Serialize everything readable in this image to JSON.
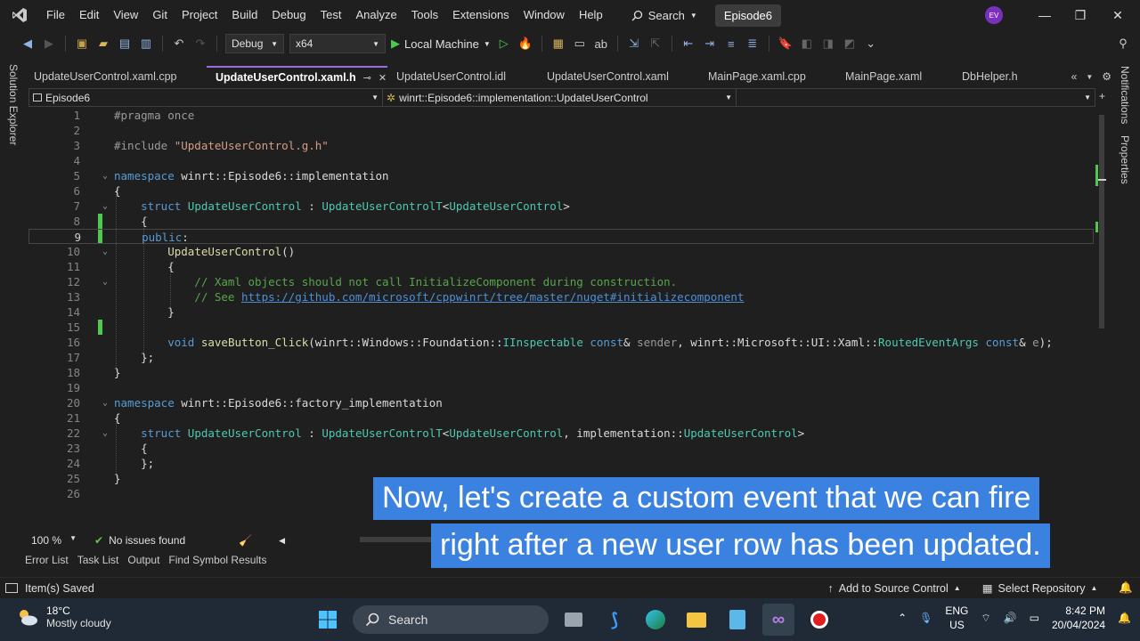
{
  "menubar": {
    "items": [
      "File",
      "Edit",
      "View",
      "Git",
      "Project",
      "Build",
      "Debug",
      "Test",
      "Analyze",
      "Tools",
      "Extensions",
      "Window",
      "Help"
    ],
    "search_label": "Search",
    "solution_name": "Episode6",
    "avatar_initials": "EV"
  },
  "toolbar": {
    "config": "Debug",
    "platform": "x64",
    "run_label": "Local Machine"
  },
  "side_panels": {
    "left": "Solution Explorer",
    "right_top": "Notifications",
    "right_bottom": "Properties"
  },
  "tabs": [
    {
      "label": "UpdateUserControl.xaml.cpp",
      "active": false
    },
    {
      "label": "UpdateUserControl.xaml.h",
      "active": true
    },
    {
      "label": "UpdateUserControl.idl",
      "active": false
    },
    {
      "label": "UpdateUserControl.xaml",
      "active": false
    },
    {
      "label": "MainPage.xaml.cpp",
      "active": false
    },
    {
      "label": "MainPage.xaml",
      "active": false
    },
    {
      "label": "DbHelper.h",
      "active": false
    }
  ],
  "navbar": {
    "project": "Episode6",
    "scope": "winrt::Episode6::implementation::UpdateUserControl",
    "member": ""
  },
  "code_lines": [
    {
      "n": "1",
      "text": "#pragma once"
    },
    {
      "n": "2",
      "text": ""
    },
    {
      "n": "3",
      "text": "#include \"UpdateUserControl.g.h\""
    },
    {
      "n": "4",
      "text": ""
    },
    {
      "n": "5",
      "text": "namespace winrt::Episode6::implementation"
    },
    {
      "n": "6",
      "text": "{"
    },
    {
      "n": "7",
      "text": "    struct UpdateUserControl : UpdateUserControlT<UpdateUserControl>"
    },
    {
      "n": "8",
      "text": "    {"
    },
    {
      "n": "9",
      "text": "    public:"
    },
    {
      "n": "10",
      "text": "        UpdateUserControl()"
    },
    {
      "n": "11",
      "text": "        {"
    },
    {
      "n": "12",
      "text": "            // Xaml objects should not call InitializeComponent during construction."
    },
    {
      "n": "13",
      "text": "            // See https://github.com/microsoft/cppwinrt/tree/master/nuget#initializecomponent"
    },
    {
      "n": "14",
      "text": "        }"
    },
    {
      "n": "15",
      "text": ""
    },
    {
      "n": "16",
      "text": "        void saveButton_Click(winrt::Windows::Foundation::IInspectable const& sender, winrt::Microsoft::UI::Xaml::RoutedEventArgs const& e);"
    },
    {
      "n": "17",
      "text": "    };"
    },
    {
      "n": "18",
      "text": "}"
    },
    {
      "n": "19",
      "text": ""
    },
    {
      "n": "20",
      "text": "namespace winrt::Episode6::factory_implementation"
    },
    {
      "n": "21",
      "text": "{"
    },
    {
      "n": "22",
      "text": "    struct UpdateUserControl : UpdateUserControlT<UpdateUserControl, implementation::UpdateUserControl>"
    },
    {
      "n": "23",
      "text": "    {"
    },
    {
      "n": "24",
      "text": "    };"
    },
    {
      "n": "25",
      "text": "}"
    },
    {
      "n": "26",
      "text": ""
    }
  ],
  "editor_status": {
    "zoom": "100 %",
    "issues": "No issues found"
  },
  "tool_windows": [
    "Error List",
    "Task List",
    "Output",
    "Find Symbol Results"
  ],
  "statusbar": {
    "message": "Item(s) Saved",
    "source_control": "Add to Source Control",
    "repository": "Select Repository"
  },
  "caption": {
    "line1": "Now, let's create a custom event that we can fire",
    "line2": "right after a new user row has been updated."
  },
  "taskbar": {
    "temperature": "18°C",
    "weather": "Mostly cloudy",
    "search": "Search",
    "lang_top": "ENG",
    "lang_bottom": "US",
    "time": "8:42 PM",
    "date": "20/04/2024"
  }
}
